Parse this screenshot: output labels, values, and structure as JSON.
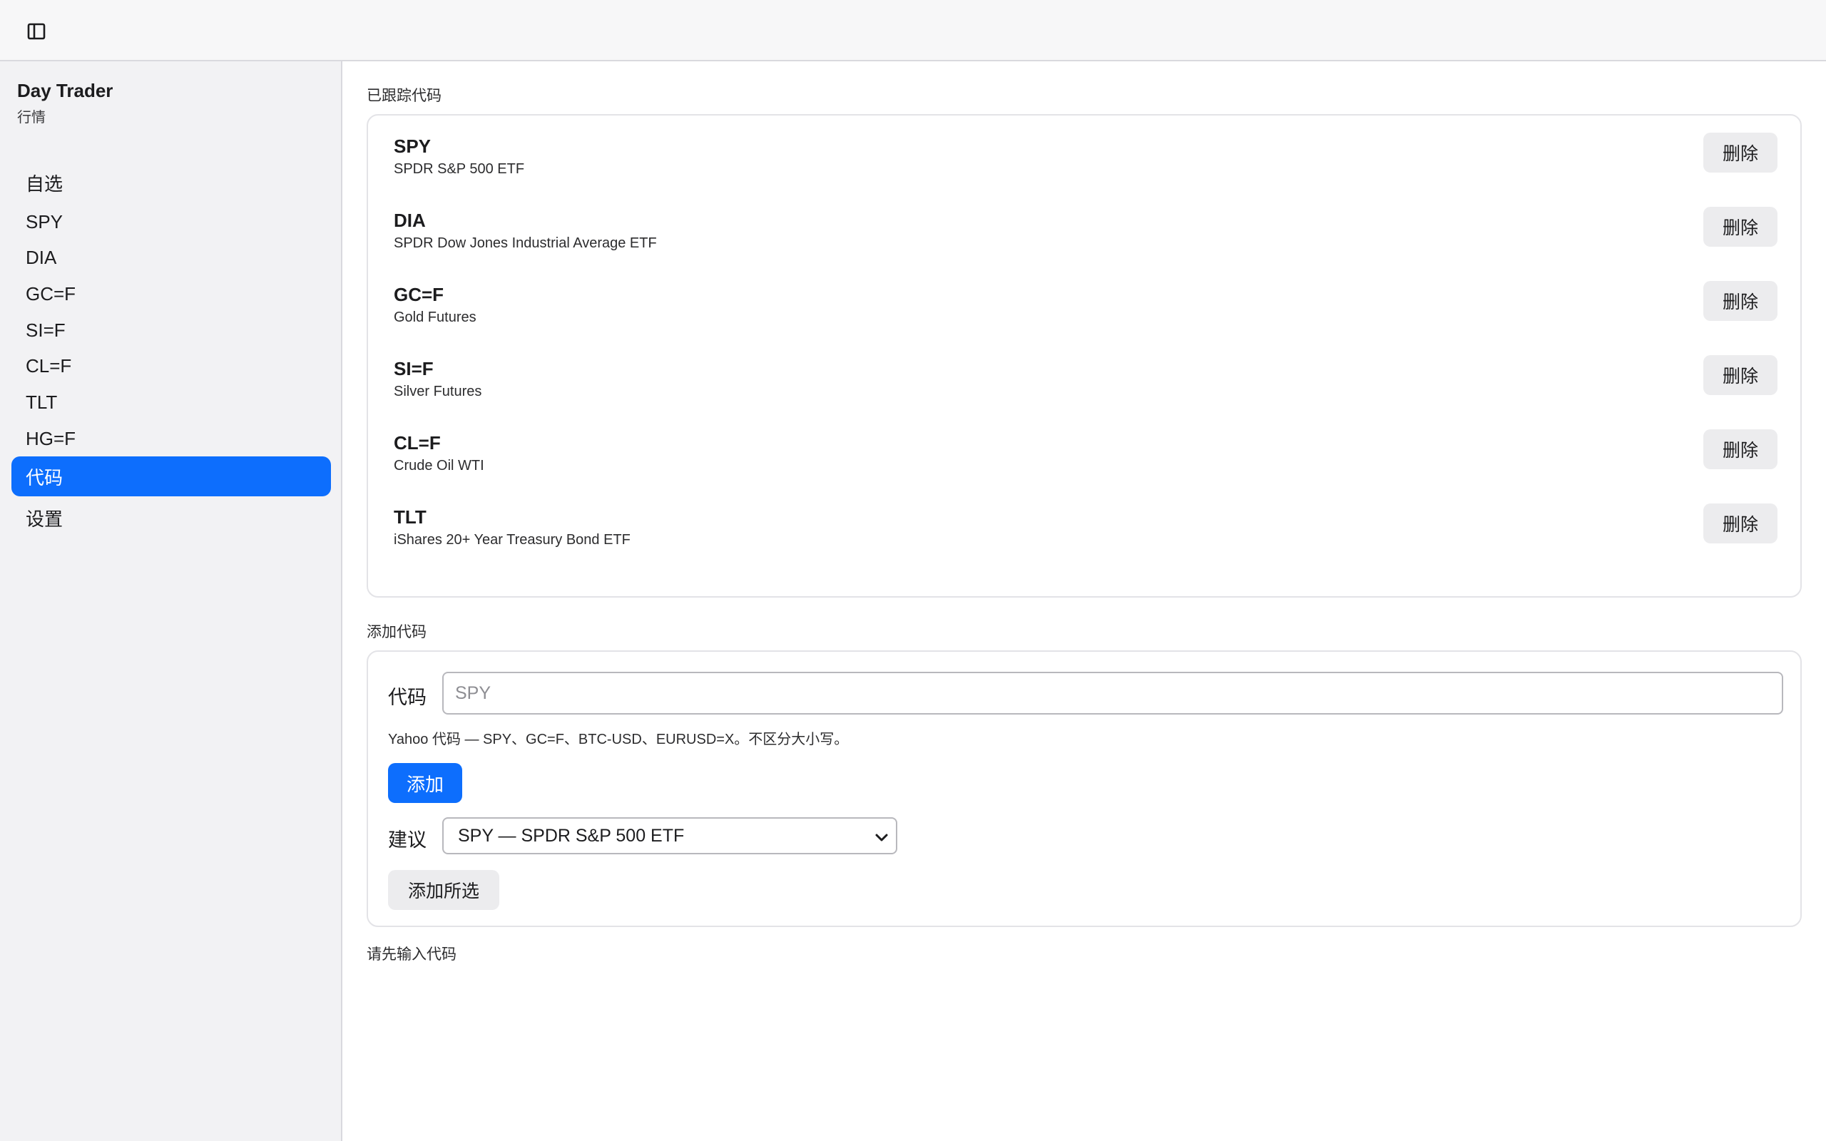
{
  "app": {
    "title": "Day Trader",
    "subtitle": "行情"
  },
  "topbar": {
    "toggle_icon": "sidebar-toggle-icon"
  },
  "sidebar": {
    "items": [
      {
        "label": "自选",
        "active": false
      },
      {
        "label": "SPY",
        "active": false
      },
      {
        "label": "DIA",
        "active": false
      },
      {
        "label": "GC=F",
        "active": false
      },
      {
        "label": "SI=F",
        "active": false
      },
      {
        "label": "CL=F",
        "active": false
      },
      {
        "label": "TLT",
        "active": false
      },
      {
        "label": "HG=F",
        "active": false
      },
      {
        "label": "代码",
        "active": true
      },
      {
        "label": "设置",
        "active": false
      }
    ]
  },
  "tracked": {
    "heading": "已跟踪代码",
    "delete_label": "删除",
    "tickers": [
      {
        "symbol": "SPY",
        "name": "SPDR S&P 500 ETF"
      },
      {
        "symbol": "DIA",
        "name": "SPDR Dow Jones Industrial Average ETF"
      },
      {
        "symbol": "GC=F",
        "name": "Gold Futures"
      },
      {
        "symbol": "SI=F",
        "name": "Silver Futures"
      },
      {
        "symbol": "CL=F",
        "name": "Crude Oil WTI"
      },
      {
        "symbol": "TLT",
        "name": "iShares 20+ Year Treasury Bond ETF"
      }
    ]
  },
  "add_form": {
    "heading": "添加代码",
    "symbol_label": "代码",
    "symbol_placeholder": "SPY",
    "symbol_value": "",
    "hint": "Yahoo 代码 — SPY、GC=F、BTC-USD、EURUSD=X。不区分大小写。",
    "add_label": "添加",
    "suggest_label": "建议",
    "suggest_selected": "SPY — SPDR S&P 500 ETF",
    "add_selected_label": "添加所选"
  },
  "status": {
    "message": "请先输入代码"
  },
  "colors": {
    "accent": "#0d6efd",
    "sidebar_bg": "#f2f2f4",
    "button_gray": "#ececee"
  }
}
